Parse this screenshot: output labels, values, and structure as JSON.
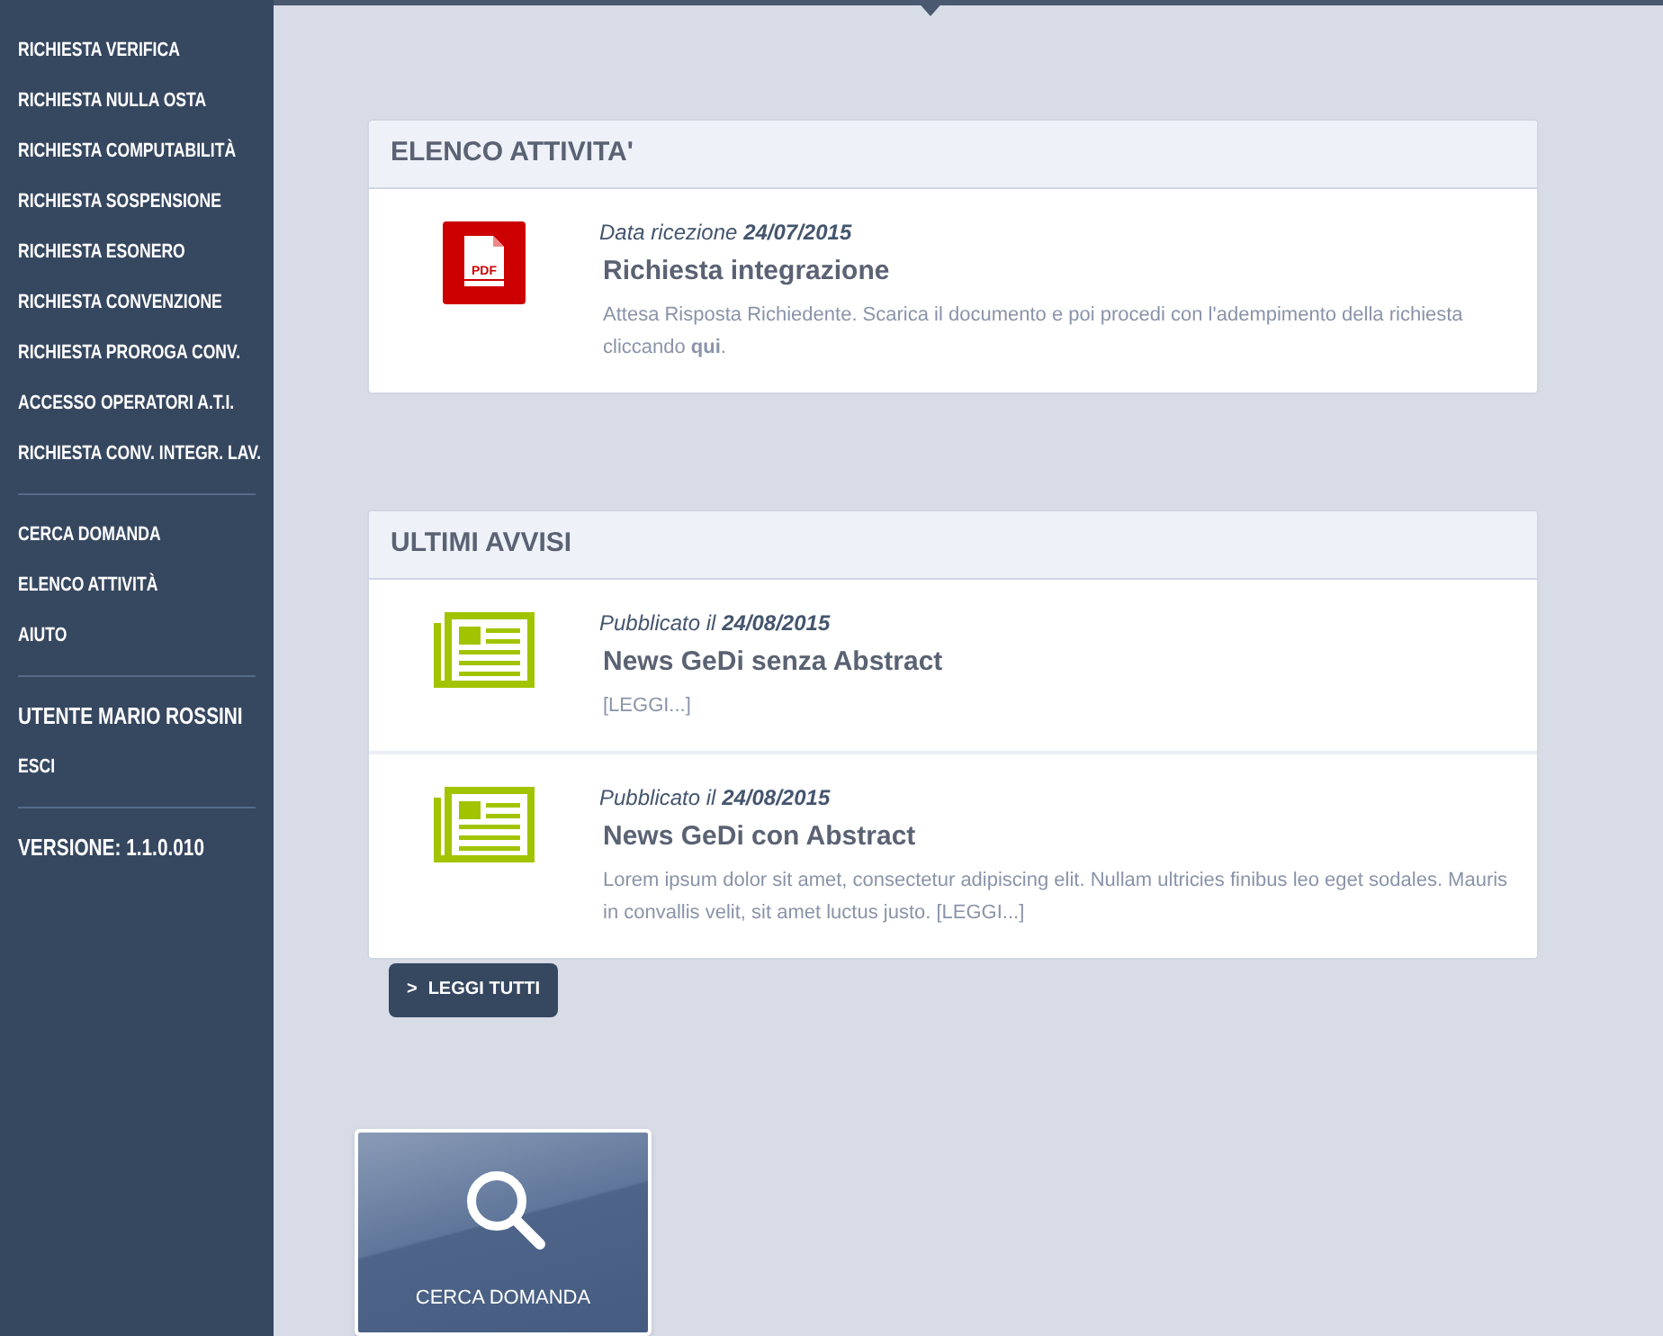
{
  "sidebar": {
    "sections": [
      {
        "items": [
          {
            "label": "RICHIESTA VERIFICA",
            "kind": "link"
          },
          {
            "label": "RICHIESTA NULLA OSTA",
            "kind": "link"
          },
          {
            "label": "RICHIESTA COMPUTABILITÀ",
            "kind": "link"
          },
          {
            "label": "RICHIESTA SOSPENSIONE",
            "kind": "link"
          },
          {
            "label": "RICHIESTA ESONERO",
            "kind": "link"
          },
          {
            "label": "RICHIESTA CONVENZIONE",
            "kind": "link"
          },
          {
            "label": "RICHIESTA PROROGA CONV.",
            "kind": "link"
          },
          {
            "label": "ACCESSO OPERATORI A.T.I.",
            "kind": "link"
          },
          {
            "label": "RICHIESTA CONV. INTEGR. LAV.",
            "kind": "link"
          }
        ]
      },
      {
        "items": [
          {
            "label": "CERCA DOMANDA",
            "kind": "link"
          },
          {
            "label": "ELENCO ATTIVITÀ",
            "kind": "link"
          },
          {
            "label": "AIUTO",
            "kind": "link"
          }
        ]
      },
      {
        "items": [
          {
            "label": "UTENTE MARIO ROSSINI",
            "kind": "heading"
          },
          {
            "label": "ESCI",
            "kind": "link"
          }
        ]
      },
      {
        "items": [
          {
            "label": "VERSIONE: 1.1.0.010",
            "kind": "heading"
          }
        ]
      }
    ]
  },
  "activities": {
    "title": "ELENCO ATTIVITA'",
    "items": [
      {
        "kind": "pdf",
        "icon_text": "PDF",
        "date_label": "Data ricezione",
        "date": "24/07/2015",
        "title": "Richiesta integrazione",
        "text": "Attesa Risposta Richiedente. Scarica il documento e poi procedi con l'adempimento della richiesta cliccando **qui**."
      }
    ]
  },
  "notices": {
    "title": "ULTIMI AVVISI",
    "items": [
      {
        "kind": "news",
        "date_label": "Pubblicato il",
        "date": "24/08/2015",
        "title": "News GeDi senza Abstract",
        "text": "[LEGGI...]"
      },
      {
        "kind": "news",
        "date_label": "Pubblicato il",
        "date": "24/08/2015",
        "title": "News GeDi con Abstract",
        "text": "Lorem ipsum dolor sit amet, consectetur adipiscing elit. Nullam ultricies finibus leo eget sodales. Mauris in convallis velit, sit amet luctus justo. [LEGGI...]"
      }
    ],
    "button": {
      "arrow": ">",
      "label": "LEGGI TUTTI"
    }
  },
  "tile": {
    "label": "CERCA DOMANDA"
  }
}
